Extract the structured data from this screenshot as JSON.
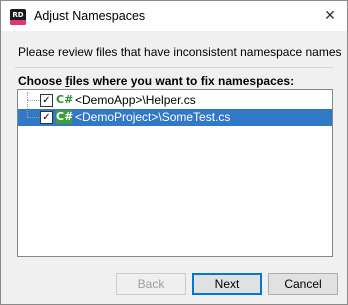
{
  "window": {
    "title": "Adjust Namespaces",
    "app_icon_label": "RD",
    "close_glyph": "✕"
  },
  "instruction_text": "Please review files that have inconsistent namespace names",
  "group": {
    "label_before": "Choose ",
    "label_mnemonic": "f",
    "label_after": "iles where you want to fix namespaces:"
  },
  "files": [
    {
      "checked": true,
      "icon": "csharp-file-icon",
      "icon_text": "C#",
      "label": "<DemoApp>\\Helper.cs",
      "selected": false
    },
    {
      "checked": true,
      "icon": "csharp-file-icon",
      "icon_text": "C#",
      "label": "<DemoProject>\\SomeTest.cs",
      "selected": true
    }
  ],
  "buttons": {
    "back": "Back",
    "next": "Next",
    "cancel": "Cancel"
  },
  "colors": {
    "selection": "#3178c6",
    "default_button_border": "#0078d7",
    "csharp_icon": "#2f8f2f"
  }
}
